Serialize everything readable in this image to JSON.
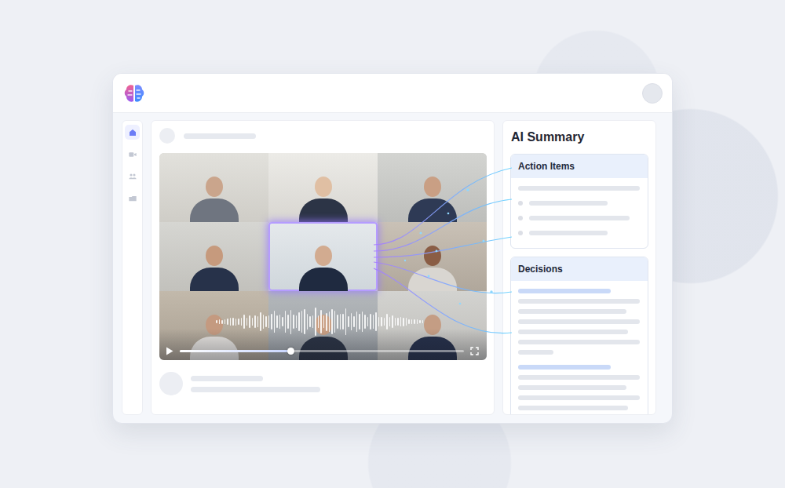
{
  "sidebar": {
    "items": [
      {
        "selected": true
      },
      {
        "selected": false
      },
      {
        "selected": false
      },
      {
        "selected": false
      }
    ]
  },
  "video": {
    "participants": [
      {
        "selected": false
      },
      {
        "selected": false
      },
      {
        "selected": false
      },
      {
        "selected": false
      },
      {
        "selected": true
      },
      {
        "selected": false
      },
      {
        "selected": false
      },
      {
        "selected": false
      },
      {
        "selected": false
      }
    ],
    "playback": {
      "level": 0.39
    }
  },
  "summary": {
    "title": "AI Summary",
    "sections": [
      {
        "title": "Action Items"
      },
      {
        "title": "Decisions"
      }
    ]
  }
}
